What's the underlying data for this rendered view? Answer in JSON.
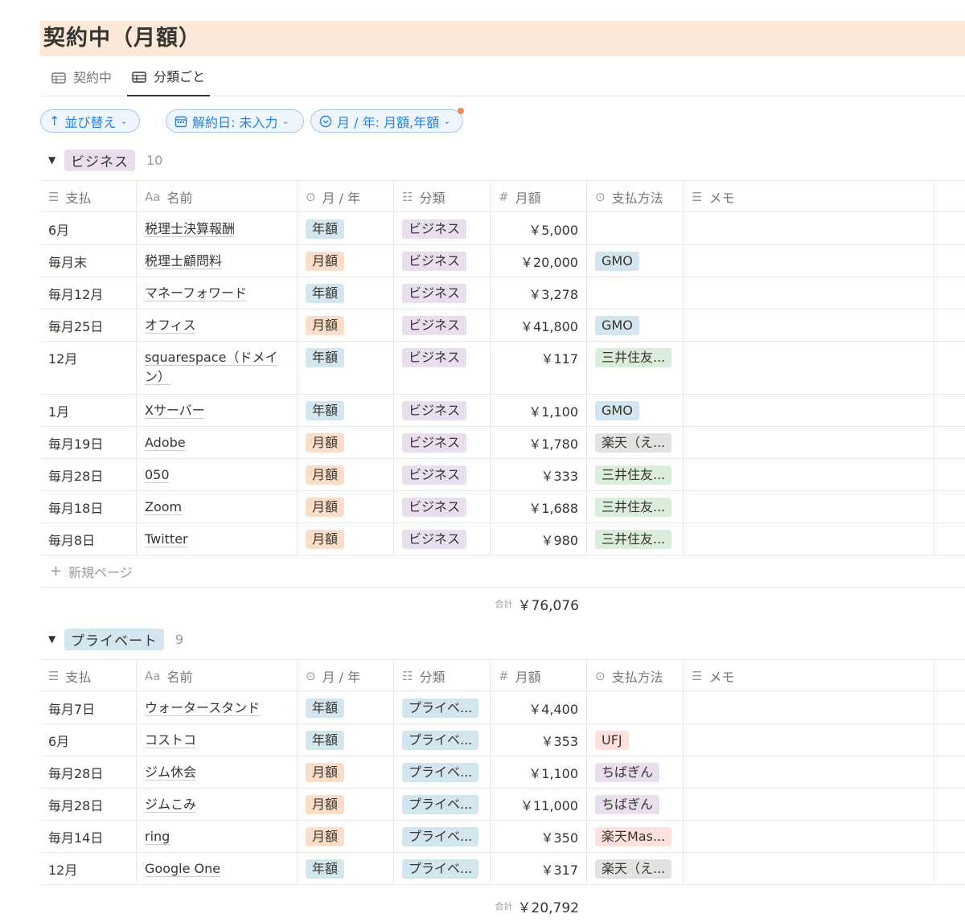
{
  "page_title": "契約中（月額）",
  "tabs": [
    {
      "label": "契約中"
    },
    {
      "label": "分類ごと"
    }
  ],
  "filters": {
    "sort": "並び替え",
    "cancel_date": "解約日: 未入力",
    "period": "月 / 年: 月額,年額"
  },
  "columns": {
    "pay": "支払",
    "name": "名前",
    "name_prefix": "Aa",
    "period": "月 / 年",
    "category": "分類",
    "amount": "月額",
    "amount_prefix": "#",
    "method": "支払方法",
    "memo": "メモ"
  },
  "colors": {
    "nenkaku": "#d3e5ef",
    "getsugaku": "#fadec9",
    "business": "#e8deee",
    "private": "#d3e5ef",
    "gmo": "#d3e5ef",
    "mitsui": "#dbeddb",
    "rakuten": "#e3e2e0",
    "ufj": "#ffe2dd",
    "chiba": "#e8deee",
    "rakutenmas": "#ffe2dd"
  },
  "groups": [
    {
      "label": "ビジネス",
      "count": "10",
      "new_page": "新規ページ",
      "sum_label": "合計",
      "sum": "￥76,076",
      "rows": [
        {
          "pay": "6月",
          "name": "税理士決算報酬",
          "period": "年額",
          "category": "ビジネス",
          "amount": "￥5,000",
          "method": ""
        },
        {
          "pay": "毎月末",
          "name": "税理士顧問料",
          "period": "月額",
          "category": "ビジネス",
          "amount": "￥20,000",
          "method": "GMO"
        },
        {
          "pay": "毎月12月",
          "name": "マネーフォワード",
          "period": "年額",
          "category": "ビジネス",
          "amount": "￥3,278",
          "method": ""
        },
        {
          "pay": "毎月25日",
          "name": "オフィス",
          "period": "月額",
          "category": "ビジネス",
          "amount": "￥41,800",
          "method": "GMO"
        },
        {
          "pay": "12月",
          "name": "squarespace（ドメイン）",
          "period": "年額",
          "category": "ビジネス",
          "amount": "￥117",
          "method": "三井住友..."
        },
        {
          "pay": "1月",
          "name": "Xサーバー",
          "period": "年額",
          "category": "ビジネス",
          "amount": "￥1,100",
          "method": "GMO"
        },
        {
          "pay": "毎月19日",
          "name": "Adobe",
          "period": "月額",
          "category": "ビジネス",
          "amount": "￥1,780",
          "method": "楽天（え..."
        },
        {
          "pay": "毎月28日",
          "name": "050",
          "period": "月額",
          "category": "ビジネス",
          "amount": "￥333",
          "method": "三井住友..."
        },
        {
          "pay": "毎月18日",
          "name": "Zoom",
          "period": "月額",
          "category": "ビジネス",
          "amount": "￥1,688",
          "method": "三井住友..."
        },
        {
          "pay": "毎月8日",
          "name": "Twitter",
          "period": "月額",
          "category": "ビジネス",
          "amount": "￥980",
          "method": "三井住友..."
        }
      ]
    },
    {
      "label": "プライベート",
      "count": "9",
      "sum_label": "合計",
      "sum": "￥20,792",
      "rows": [
        {
          "pay": "毎月7日",
          "name": "ウォータースタンド",
          "period": "年額",
          "category": "プライベ...",
          "amount": "￥4,400",
          "method": ""
        },
        {
          "pay": "6月",
          "name": "コストコ",
          "period": "年額",
          "category": "プライベ...",
          "amount": "￥353",
          "method": "UFJ"
        },
        {
          "pay": "毎月28日",
          "name": "ジム休会",
          "period": "月額",
          "category": "プライベ...",
          "amount": "￥1,100",
          "method": "ちばぎん"
        },
        {
          "pay": "毎月28日",
          "name": "ジムこみ",
          "period": "月額",
          "category": "プライベ...",
          "amount": "￥11,000",
          "method": "ちばぎん"
        },
        {
          "pay": "毎月14日",
          "name": "ring",
          "period": "月額",
          "category": "プライベ...",
          "amount": "￥350",
          "method": "楽天Mas..."
        },
        {
          "pay": "12月",
          "name": "Google One",
          "period": "年額",
          "category": "プライベ...",
          "amount": "￥317",
          "method": "楽天（え..."
        }
      ]
    }
  ]
}
